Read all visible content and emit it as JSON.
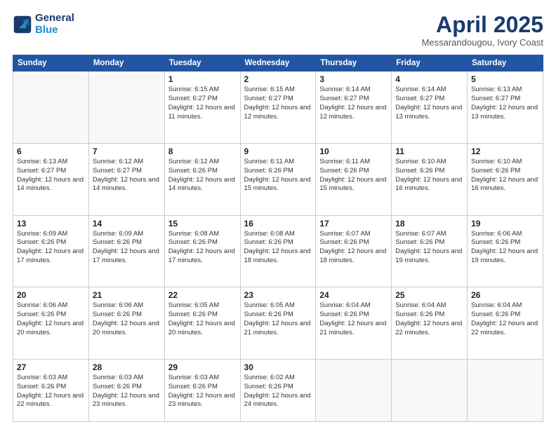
{
  "header": {
    "logo_line1": "General",
    "logo_line2": "Blue",
    "month_title": "April 2025",
    "subtitle": "Messarandougou, Ivory Coast"
  },
  "days_of_week": [
    "Sunday",
    "Monday",
    "Tuesday",
    "Wednesday",
    "Thursday",
    "Friday",
    "Saturday"
  ],
  "weeks": [
    [
      {
        "day": "",
        "info": ""
      },
      {
        "day": "",
        "info": ""
      },
      {
        "day": "1",
        "info": "Sunrise: 6:15 AM\nSunset: 6:27 PM\nDaylight: 12 hours and 11 minutes."
      },
      {
        "day": "2",
        "info": "Sunrise: 6:15 AM\nSunset: 6:27 PM\nDaylight: 12 hours and 12 minutes."
      },
      {
        "day": "3",
        "info": "Sunrise: 6:14 AM\nSunset: 6:27 PM\nDaylight: 12 hours and 12 minutes."
      },
      {
        "day": "4",
        "info": "Sunrise: 6:14 AM\nSunset: 6:27 PM\nDaylight: 12 hours and 13 minutes."
      },
      {
        "day": "5",
        "info": "Sunrise: 6:13 AM\nSunset: 6:27 PM\nDaylight: 12 hours and 13 minutes."
      }
    ],
    [
      {
        "day": "6",
        "info": "Sunrise: 6:13 AM\nSunset: 6:27 PM\nDaylight: 12 hours and 14 minutes."
      },
      {
        "day": "7",
        "info": "Sunrise: 6:12 AM\nSunset: 6:27 PM\nDaylight: 12 hours and 14 minutes."
      },
      {
        "day": "8",
        "info": "Sunrise: 6:12 AM\nSunset: 6:26 PM\nDaylight: 12 hours and 14 minutes."
      },
      {
        "day": "9",
        "info": "Sunrise: 6:11 AM\nSunset: 6:26 PM\nDaylight: 12 hours and 15 minutes."
      },
      {
        "day": "10",
        "info": "Sunrise: 6:11 AM\nSunset: 6:26 PM\nDaylight: 12 hours and 15 minutes."
      },
      {
        "day": "11",
        "info": "Sunrise: 6:10 AM\nSunset: 6:26 PM\nDaylight: 12 hours and 16 minutes."
      },
      {
        "day": "12",
        "info": "Sunrise: 6:10 AM\nSunset: 6:26 PM\nDaylight: 12 hours and 16 minutes."
      }
    ],
    [
      {
        "day": "13",
        "info": "Sunrise: 6:09 AM\nSunset: 6:26 PM\nDaylight: 12 hours and 17 minutes."
      },
      {
        "day": "14",
        "info": "Sunrise: 6:09 AM\nSunset: 6:26 PM\nDaylight: 12 hours and 17 minutes."
      },
      {
        "day": "15",
        "info": "Sunrise: 6:08 AM\nSunset: 6:26 PM\nDaylight: 12 hours and 17 minutes."
      },
      {
        "day": "16",
        "info": "Sunrise: 6:08 AM\nSunset: 6:26 PM\nDaylight: 12 hours and 18 minutes."
      },
      {
        "day": "17",
        "info": "Sunrise: 6:07 AM\nSunset: 6:26 PM\nDaylight: 12 hours and 18 minutes."
      },
      {
        "day": "18",
        "info": "Sunrise: 6:07 AM\nSunset: 6:26 PM\nDaylight: 12 hours and 19 minutes."
      },
      {
        "day": "19",
        "info": "Sunrise: 6:06 AM\nSunset: 6:26 PM\nDaylight: 12 hours and 19 minutes."
      }
    ],
    [
      {
        "day": "20",
        "info": "Sunrise: 6:06 AM\nSunset: 6:26 PM\nDaylight: 12 hours and 20 minutes."
      },
      {
        "day": "21",
        "info": "Sunrise: 6:06 AM\nSunset: 6:26 PM\nDaylight: 12 hours and 20 minutes."
      },
      {
        "day": "22",
        "info": "Sunrise: 6:05 AM\nSunset: 6:26 PM\nDaylight: 12 hours and 20 minutes."
      },
      {
        "day": "23",
        "info": "Sunrise: 6:05 AM\nSunset: 6:26 PM\nDaylight: 12 hours and 21 minutes."
      },
      {
        "day": "24",
        "info": "Sunrise: 6:04 AM\nSunset: 6:26 PM\nDaylight: 12 hours and 21 minutes."
      },
      {
        "day": "25",
        "info": "Sunrise: 6:04 AM\nSunset: 6:26 PM\nDaylight: 12 hours and 22 minutes."
      },
      {
        "day": "26",
        "info": "Sunrise: 6:04 AM\nSunset: 6:26 PM\nDaylight: 12 hours and 22 minutes."
      }
    ],
    [
      {
        "day": "27",
        "info": "Sunrise: 6:03 AM\nSunset: 6:26 PM\nDaylight: 12 hours and 22 minutes."
      },
      {
        "day": "28",
        "info": "Sunrise: 6:03 AM\nSunset: 6:26 PM\nDaylight: 12 hours and 23 minutes."
      },
      {
        "day": "29",
        "info": "Sunrise: 6:03 AM\nSunset: 6:26 PM\nDaylight: 12 hours and 23 minutes."
      },
      {
        "day": "30",
        "info": "Sunrise: 6:02 AM\nSunset: 6:26 PM\nDaylight: 12 hours and 24 minutes."
      },
      {
        "day": "",
        "info": ""
      },
      {
        "day": "",
        "info": ""
      },
      {
        "day": "",
        "info": ""
      }
    ]
  ]
}
